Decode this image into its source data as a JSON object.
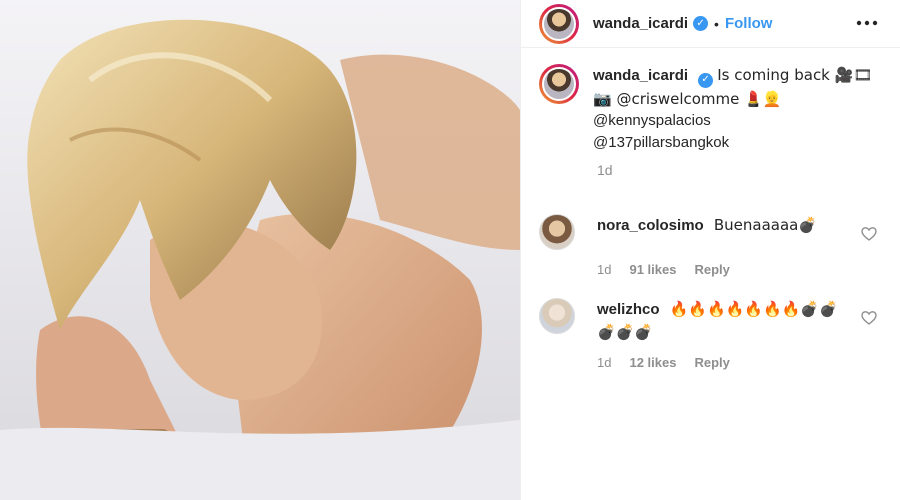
{
  "post": {
    "author": "wanda_icardi",
    "follow_label": "Follow",
    "dot": "•",
    "verified_mark": "✓"
  },
  "caption": {
    "author": "wanda_icardi",
    "text": "Is coming back 🎥🎞",
    "line2": "📷 @criswelcomme 💄👱",
    "line3": "@kennyspalacios",
    "line4": "@137pillarsbangkok",
    "time": "1d"
  },
  "comments": [
    {
      "user": "nora_colosimo",
      "text": "Buenaaaaa💣",
      "time": "1d",
      "likes": "91 likes",
      "reply": "Reply"
    },
    {
      "user": "welizhco",
      "text": "🔥🔥🔥🔥🔥🔥🔥💣💣",
      "text2": "💣💣💣",
      "time": "1d",
      "likes": "12 likes",
      "reply": "Reply"
    }
  ],
  "icons": {
    "more": "more-options-icon",
    "heart": "heart-icon",
    "verified": "verified-badge-icon"
  },
  "colors": {
    "link": "#3897f0",
    "muted": "#8e8e8e",
    "text": "#262626"
  }
}
